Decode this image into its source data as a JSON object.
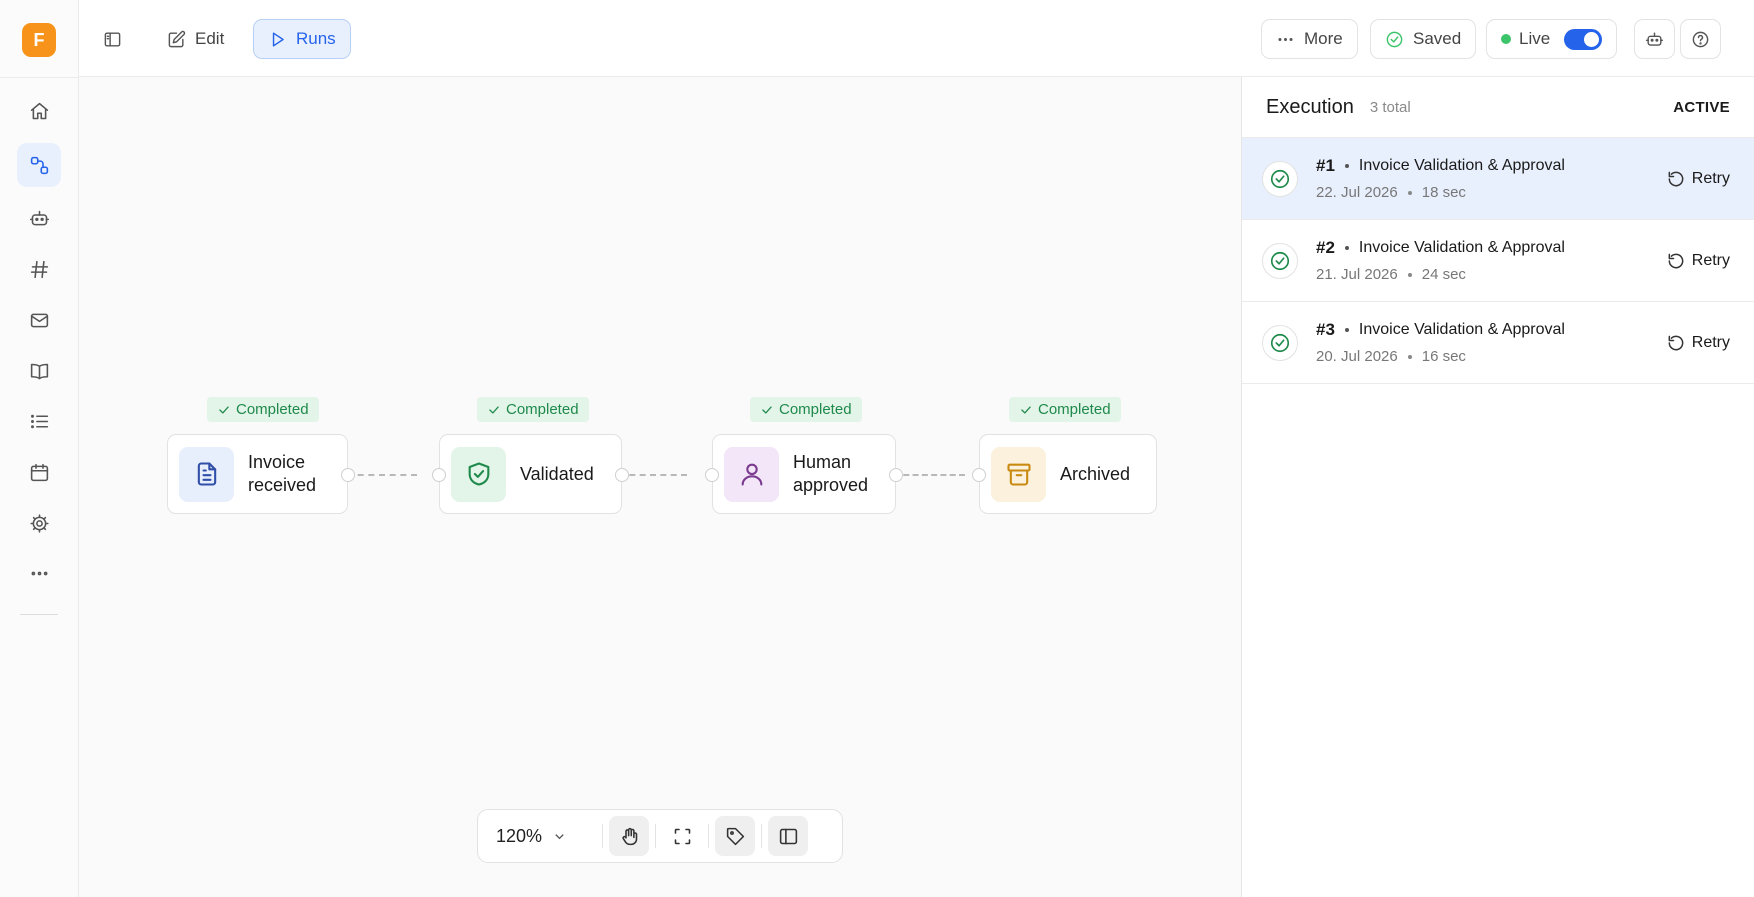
{
  "app": {
    "logo_letter": "F"
  },
  "rail": {
    "items": [
      {
        "icon": "home-icon"
      },
      {
        "icon": "workflow-icon",
        "active": true
      },
      {
        "icon": "bot-icon"
      },
      {
        "icon": "hash-icon"
      },
      {
        "icon": "mail-icon"
      },
      {
        "icon": "book-icon"
      },
      {
        "icon": "list-icon"
      },
      {
        "icon": "calendar-icon"
      },
      {
        "icon": "gear-icon"
      },
      {
        "icon": "more-horizontal-icon"
      }
    ]
  },
  "toolbar": {
    "edit_label": "Edit",
    "runs_label": "Runs",
    "more_label": "More",
    "saved_label": "Saved",
    "live_label": "Live",
    "live_on": true
  },
  "workflow": {
    "nodes": [
      {
        "label": "Invoice received",
        "status": "Completed",
        "icon": "document-icon",
        "color": "#e8effc",
        "stroke": "#2f4fa8"
      },
      {
        "label": "Validated",
        "status": "Completed",
        "icon": "shield-check-icon",
        "color": "#e3f4e8",
        "stroke": "#1f8a4c"
      },
      {
        "label": "Human approved",
        "status": "Completed",
        "icon": "user-icon",
        "color": "#f3e6f8",
        "stroke": "#7a3a8f"
      },
      {
        "label": "Archived",
        "status": "Completed",
        "icon": "archive-icon",
        "color": "#fcf1dc",
        "stroke": "#c98a12"
      }
    ]
  },
  "zoom": {
    "value": "120%"
  },
  "execution": {
    "title": "Execution",
    "count": "3 total",
    "filter": "ACTIVE",
    "runs": [
      {
        "num": "#1",
        "name": "Invoice Validation & Approval",
        "date": "22. Jul 2026",
        "duration": "18 sec",
        "action": "Retry",
        "selected": true
      },
      {
        "num": "#2",
        "name": "Invoice Validation & Approval",
        "date": "21. Jul 2026",
        "duration": "24 sec",
        "action": "Retry"
      },
      {
        "num": "#3",
        "name": "Invoice Validation & Approval",
        "date": "20. Jul 2026",
        "duration": "16 sec",
        "action": "Retry"
      }
    ]
  },
  "colors": {
    "accent": "#2563eb",
    "success": "#1f8a4c",
    "brand": "#f7931a"
  }
}
